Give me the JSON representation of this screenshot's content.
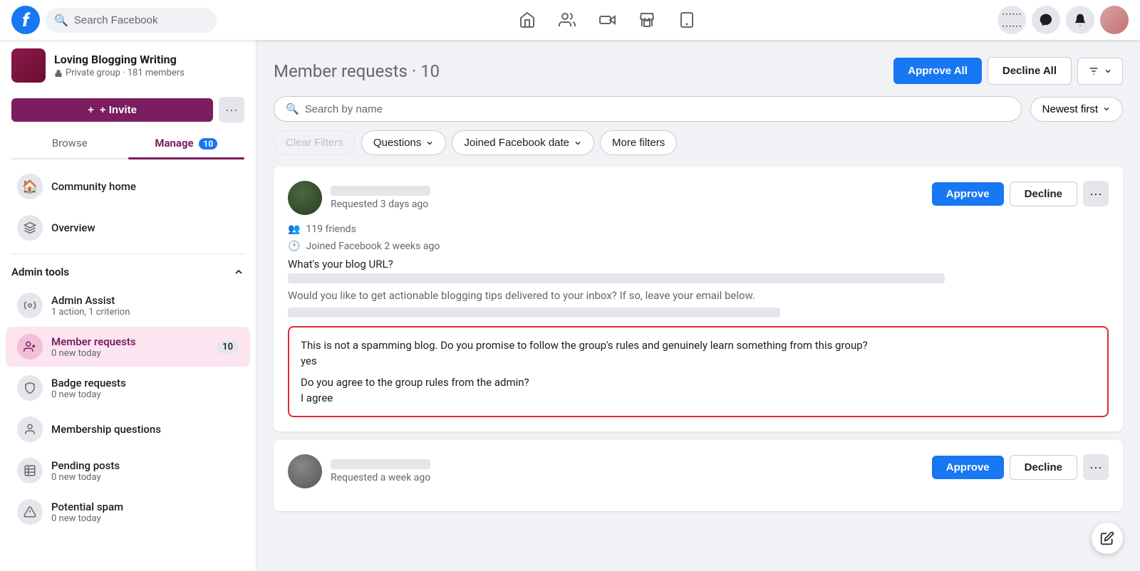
{
  "topnav": {
    "logo_letter": "f",
    "search_placeholder": "Search Facebook",
    "nav_icons": [
      "home",
      "people",
      "video",
      "store",
      "menu-square"
    ],
    "right_icons": [
      "grid-dots",
      "messenger",
      "bell"
    ]
  },
  "sidebar": {
    "group_name": "Loving Blogging Writing",
    "group_meta": "Private group · 181 members",
    "invite_label": "+ Invite",
    "tabs": [
      {
        "label": "Browse",
        "active": false
      },
      {
        "label": "Manage",
        "active": true,
        "badge": "10"
      }
    ],
    "nav_items": [
      {
        "id": "community-home",
        "icon": "🏠",
        "title": "Community home",
        "sub": "",
        "active": false
      },
      {
        "id": "overview",
        "icon": "◫",
        "title": "Overview",
        "sub": "",
        "active": false
      }
    ],
    "admin_tools_label": "Admin tools",
    "admin_items": [
      {
        "id": "admin-assist",
        "icon": "⚙",
        "title": "Admin Assist",
        "sub": "1 action, 1 criterion",
        "badge": "",
        "active": false
      },
      {
        "id": "member-requests",
        "icon": "👥",
        "title": "Member requests",
        "sub": "0 new today",
        "badge": "10",
        "active": true
      },
      {
        "id": "badge-requests",
        "icon": "🛡",
        "title": "Badge requests",
        "sub": "0 new today",
        "badge": "",
        "active": false
      },
      {
        "id": "membership-questions",
        "icon": "👤",
        "title": "Membership questions",
        "sub": "",
        "badge": "",
        "active": false
      },
      {
        "id": "pending-posts",
        "icon": "📋",
        "title": "Pending posts",
        "sub": "0 new today",
        "badge": "",
        "active": false
      },
      {
        "id": "potential-spam",
        "icon": "⚠",
        "title": "Potential spam",
        "sub": "0 new today",
        "badge": "",
        "active": false
      }
    ]
  },
  "main": {
    "title": "Member requests",
    "count": "10",
    "approve_all_label": "Approve All",
    "decline_all_label": "Decline All",
    "search_placeholder": "Search by name",
    "sort_label": "Newest first",
    "filters": {
      "clear_label": "Clear Filters",
      "questions_label": "Questions",
      "joined_label": "Joined Facebook date",
      "more_label": "More filters"
    },
    "cards": [
      {
        "id": "card1",
        "time": "Requested 3 days ago",
        "friends": "119 friends",
        "joined": "Joined Facebook 2 weeks ago",
        "blog_question": "What's your blog URL?",
        "questions_box": {
          "q1": "This is not a spamming blog. Do you promise to follow the group's rules and genuinely learn something from this group?",
          "a1": "yes",
          "q2": "Do you agree to the group rules from the admin?",
          "a2": "I agree"
        }
      },
      {
        "id": "card2",
        "time": "Requested a week ago"
      }
    ]
  }
}
